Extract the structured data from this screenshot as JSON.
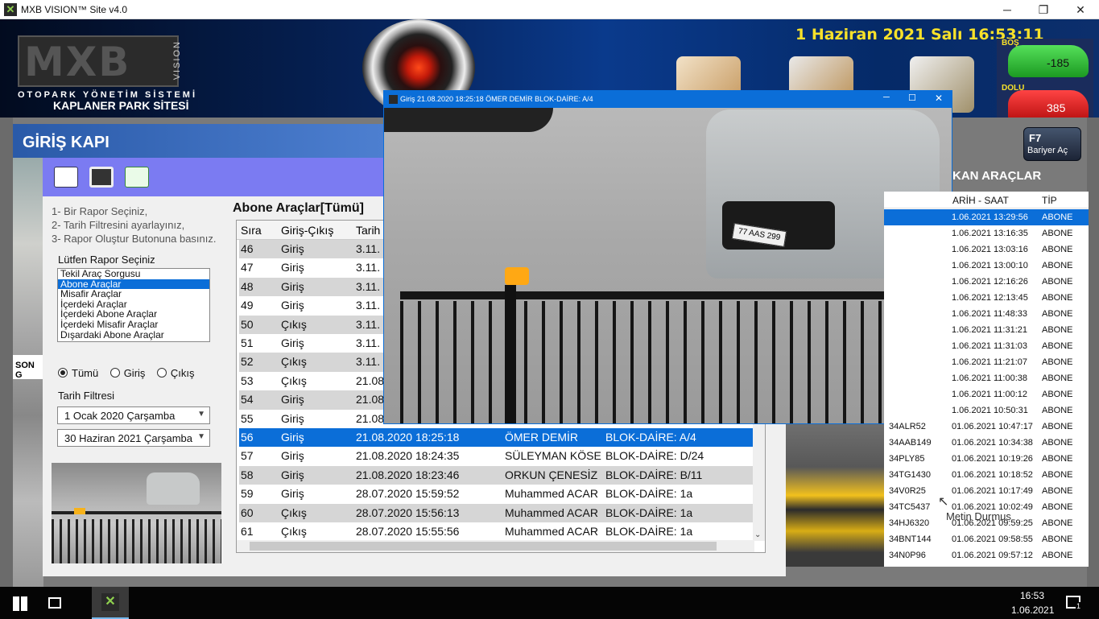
{
  "window": {
    "title": "MXB VISION™ Site v4.0"
  },
  "banner": {
    "logo_letters": "MXB",
    "logo_vision": "VISION",
    "subtitle1": "OTOPARK YÖNETİM SİSTEMİ",
    "subtitle2": "KAPLANER PARK SİTESİ",
    "datetime": "1 Haziran 2021 Salı 16:53:11",
    "bos_label": "BOŞ",
    "bos_value": "-185",
    "dolu_label": "DOLU",
    "dolu_value": "385"
  },
  "header": {
    "title": "GİRİŞ KAPI",
    "side_label": "SON G"
  },
  "report": {
    "steps": [
      "1- Bir Rapor Seçiniz,",
      "2- Tarih Filtresini ayarlayınız,",
      "3- Rapor Oluştur Butonuna basınız."
    ],
    "select_label": "Lütfen Rapor Seçiniz",
    "options": [
      "Tekil Araç Sorgusu",
      "Abone Araçlar",
      "Misafir Araçlar",
      "İçerdeki Araçlar",
      "İçerdeki Abone Araçlar",
      "İçerdeki Misafir Araçlar",
      "Dışardaki Abone Araçlar"
    ],
    "selected_option": "Abone Araçlar",
    "radio": {
      "all": "Tümü",
      "in": "Giriş",
      "out": "Çıkış",
      "selected": "Tümü"
    },
    "date_filter_label": "Tarih Filtresi",
    "date_from": "1   Ocak   2020 Çarşamba",
    "date_to": "30 Haziran  2021 Çarşamba",
    "grid_title": "Abone Araçlar[Tümü]",
    "columns": [
      "Sıra",
      "Giriş-Çıkış",
      "Tarih"
    ],
    "rows": [
      {
        "no": "46",
        "dir": "Giriş",
        "date": "3.11.",
        "name": "",
        "flat": ""
      },
      {
        "no": "47",
        "dir": "Giriş",
        "date": "3.11.",
        "name": "",
        "flat": ""
      },
      {
        "no": "48",
        "dir": "Giriş",
        "date": "3.11.",
        "name": "",
        "flat": ""
      },
      {
        "no": "49",
        "dir": "Giriş",
        "date": "3.11.",
        "name": "",
        "flat": ""
      },
      {
        "no": "50",
        "dir": "Çıkış",
        "date": "3.11.",
        "name": "",
        "flat": ""
      },
      {
        "no": "51",
        "dir": "Giriş",
        "date": "3.11.",
        "name": "",
        "flat": ""
      },
      {
        "no": "52",
        "dir": "Çıkış",
        "date": "3.11.",
        "name": "",
        "flat": ""
      },
      {
        "no": "53",
        "dir": "Çıkış",
        "date": "21.08",
        "name": "",
        "flat": ""
      },
      {
        "no": "54",
        "dir": "Giriş",
        "date": "21.08",
        "name": "",
        "flat": ""
      },
      {
        "no": "55",
        "dir": "Giriş",
        "date": "21.08",
        "name": "",
        "flat": ""
      },
      {
        "no": "56",
        "dir": "Giriş",
        "date": "21.08.2020 18:25:18",
        "name": "ÖMER DEMİR",
        "flat": "BLOK-DAİRE: A/4"
      },
      {
        "no": "57",
        "dir": "Giriş",
        "date": "21.08.2020 18:24:35",
        "name": "SÜLEYMAN KÖSE",
        "flat": "BLOK-DAİRE: D/24"
      },
      {
        "no": "58",
        "dir": "Giriş",
        "date": "21.08.2020 18:23:46",
        "name": "ORKUN ÇENESİZ",
        "flat": "BLOK-DAİRE: B/11"
      },
      {
        "no": "59",
        "dir": "Giriş",
        "date": "28.07.2020 15:59:52",
        "name": "Muhammed ACAR",
        "flat": "BLOK-DAİRE: 1a"
      },
      {
        "no": "60",
        "dir": "Çıkış",
        "date": "28.07.2020 15:56:13",
        "name": "Muhammed ACAR",
        "flat": "BLOK-DAİRE: 1a"
      },
      {
        "no": "61",
        "dir": "Çıkış",
        "date": "28.07.2020 15:55:56",
        "name": "Muhammed ACAR",
        "flat": "BLOK-DAİRE: 1a"
      }
    ],
    "selected_row": "56"
  },
  "camera": {
    "title": "Giriş 21.08.2020 18:25:18 ÖMER DEMİR   BLOK-DAİRE: A/4",
    "plate": "77 AAS 299"
  },
  "barrier": {
    "key": "F7",
    "label": "Bariyer Aç"
  },
  "exits": {
    "title": "KAN ARAÇLAR",
    "columns": [
      "ARİH - SAAT",
      "TİP"
    ],
    "rows": [
      {
        "plate": "",
        "time": "1.06.2021 13:29:56",
        "type": "ABONE"
      },
      {
        "plate": "",
        "time": "1.06.2021 13:16:35",
        "type": "ABONE"
      },
      {
        "plate": "",
        "time": "1.06.2021 13:03:16",
        "type": "ABONE"
      },
      {
        "plate": "",
        "time": "1.06.2021 13:00:10",
        "type": "ABONE"
      },
      {
        "plate": "",
        "time": "1.06.2021 12:16:26",
        "type": "ABONE"
      },
      {
        "plate": "",
        "time": "1.06.2021 12:13:45",
        "type": "ABONE"
      },
      {
        "plate": "",
        "time": "1.06.2021 11:48:33",
        "type": "ABONE"
      },
      {
        "plate": "",
        "time": "1.06.2021 11:31:21",
        "type": "ABONE"
      },
      {
        "plate": "",
        "time": "1.06.2021 11:31:03",
        "type": "ABONE"
      },
      {
        "plate": "",
        "time": "1.06.2021 11:21:07",
        "type": "ABONE"
      },
      {
        "plate": "",
        "time": "1.06.2021 11:00:38",
        "type": "ABONE"
      },
      {
        "plate": "",
        "time": "1.06.2021 11:00:12",
        "type": "ABONE"
      },
      {
        "plate": "",
        "time": "1.06.2021 10:50:31",
        "type": "ABONE"
      },
      {
        "plate": "34ALR52",
        "time": "01.06.2021 10:47:17",
        "type": "ABONE"
      },
      {
        "plate": "34AAB149",
        "time": "01.06.2021 10:34:38",
        "type": "ABONE"
      },
      {
        "plate": "34PLY85",
        "time": "01.06.2021 10:19:26",
        "type": "ABONE"
      },
      {
        "plate": "34TG1430",
        "time": "01.06.2021 10:18:52",
        "type": "ABONE"
      },
      {
        "plate": "34V0R25",
        "time": "01.06.2021 10:17:49",
        "type": "ABONE"
      },
      {
        "plate": "34TC5437",
        "time": "01.06.2021 10:02:49",
        "type": "ABONE"
      },
      {
        "plate": "34HJ6320",
        "time": "01.06.2021 09:59:25",
        "type": "ABONE"
      },
      {
        "plate": "34BNT144",
        "time": "01.06.2021 09:58:55",
        "type": "ABONE"
      },
      {
        "plate": "34N0P96",
        "time": "01.06.2021 09:57:12",
        "type": "ABONE"
      }
    ],
    "overlay_name": "Metin Durmus"
  },
  "taskbar": {
    "time": "16:53",
    "date": "1.06.2021",
    "notifications": "1"
  }
}
